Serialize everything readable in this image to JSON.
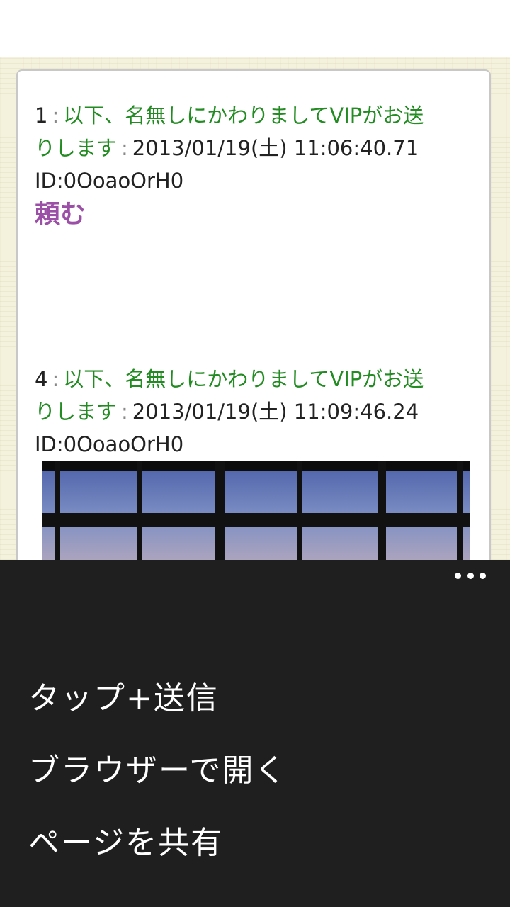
{
  "posts": [
    {
      "number": "1",
      "separator": ":",
      "name_line1": "以下、名無しにかわりましてVIPがお送",
      "name_line2": "りします",
      "separator2": ":",
      "date": "2013/01/19(土) 11:06:40.71",
      "id": "ID:0OoaoOrH0",
      "body": "頼む"
    },
    {
      "number": "4",
      "separator": ":",
      "name_line1": "以下、名無しにかわりましてVIPがお送",
      "name_line2": "りします",
      "separator2": ":",
      "date": "2013/01/19(土) 11:09:46.24",
      "id": "ID:0OoaoOrH0"
    }
  ],
  "menu": {
    "more_icon": "more-horizontal-icon",
    "items": [
      {
        "label": "タップ+送信"
      },
      {
        "label": "ブラウザーで開く"
      },
      {
        "label": "ページを共有"
      }
    ]
  },
  "colors": {
    "name": "#228b22",
    "body_text": "#9b4fa6",
    "menu_bg": "#1f1f1f",
    "page_bg": "#f4f1dc"
  }
}
